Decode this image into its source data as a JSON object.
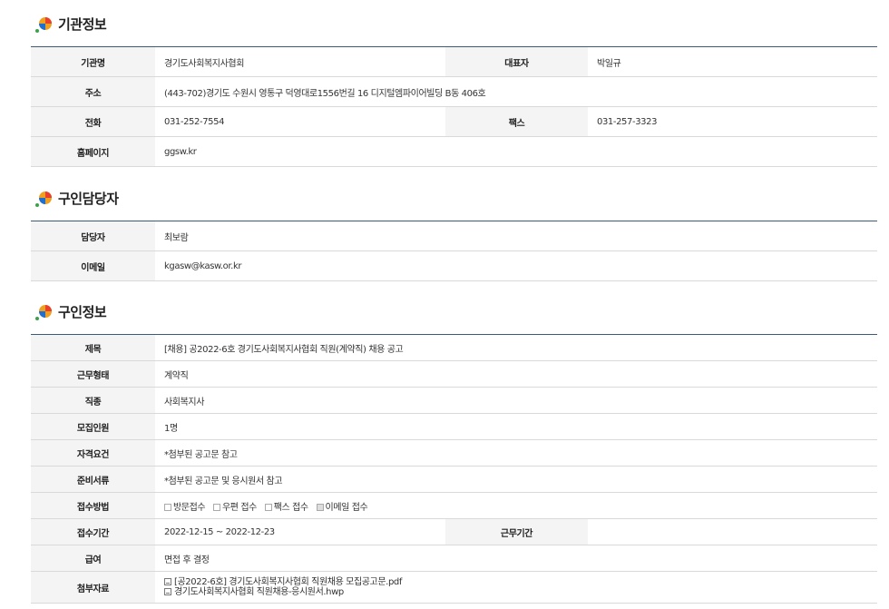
{
  "org": {
    "title": "기관정보",
    "name_label": "기관명",
    "name": "경기도사회복지사협회",
    "ceo_label": "대표자",
    "ceo": "박일규",
    "address_label": "주소",
    "address": "(443-702)경기도 수원시 영통구 덕영대로1556번길 16 디지털엠파이어빌딩 B동 406호",
    "phone_label": "전화",
    "phone": "031-252-7554",
    "fax_label": "팩스",
    "fax": "031-257-3323",
    "homepage_label": "홈페이지",
    "homepage": "ggsw.kr"
  },
  "contact": {
    "title": "구인담당자",
    "person_label": "담당자",
    "person": "최보람",
    "email_label": "이메일",
    "email": "kgasw@kasw.or.kr"
  },
  "job": {
    "title": "구인정보",
    "subject_label": "제목",
    "subject": "[채용] 공2022-6호 경기도사회복지사협회 직원(계약직) 채용 공고",
    "type_label": "근무형태",
    "type": "계약직",
    "category_label": "직종",
    "category": "사회복지사",
    "count_label": "모집인원",
    "count": "1명",
    "qual_label": "자격요건",
    "qual": "*첨부된 공고문 참고",
    "docs_label": "준비서류",
    "docs": "*첨부된 공고문 및 응시원서 참고",
    "method_label": "접수방법",
    "methods": [
      {
        "label": "방문접수",
        "checked": false
      },
      {
        "label": "우편 접수",
        "checked": false
      },
      {
        "label": "팩스 접수",
        "checked": false
      },
      {
        "label": "이메일 접수",
        "checked": true
      }
    ],
    "period_label": "접수기간",
    "period": "2022-12-15 ~ 2022-12-23",
    "work_period_label": "근무기간",
    "work_period": "",
    "salary_label": "급여",
    "salary": "면접 후 결정",
    "attach_label": "첨부자료",
    "attachments": [
      "[공2022-6호] 경기도사회복지사협회 직원채용 모집공고문.pdf",
      "경기도사회복지사협회 직원채용-응시원서.hwp"
    ]
  },
  "icon": "section-bullet-icon",
  "colors": {
    "table_top_border": "#3b5b78",
    "header_bg": "#f4f4f4"
  }
}
